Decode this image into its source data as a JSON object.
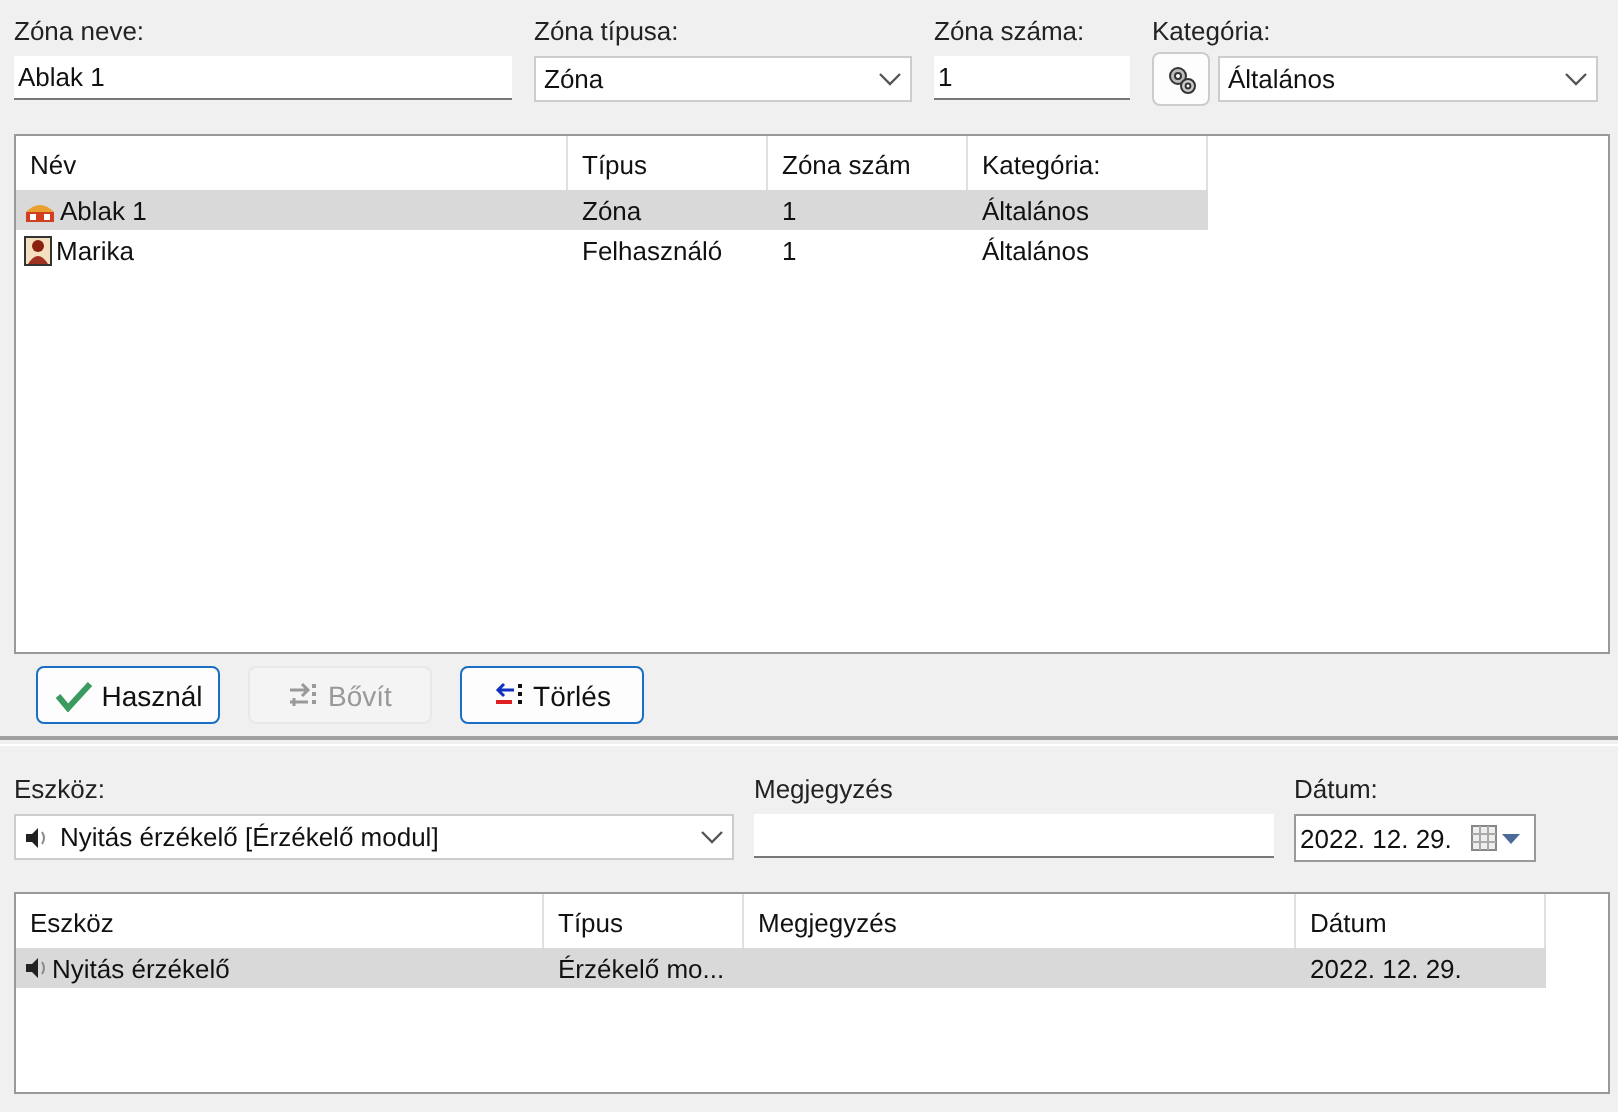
{
  "top_fields": [
    {
      "kind": "text",
      "label": "Zóna neve:",
      "value": "Ablak 1"
    },
    {
      "kind": "select",
      "label": "Zóna típusa:",
      "value": "Zóna"
    },
    {
      "kind": "text",
      "label": "Zóna száma:",
      "value": "1"
    },
    {
      "kind": "category",
      "label": "Kategória:",
      "value": "Általános"
    }
  ],
  "zones_table": {
    "columns": [
      "Név",
      "Típus",
      "Zóna szám",
      "Kategória:"
    ],
    "rows": [
      {
        "kind": "zone",
        "selected": true,
        "cells": [
          "Ablak 1",
          "Zóna",
          "1",
          "Általános"
        ]
      },
      {
        "kind": "user",
        "selected": false,
        "cells": [
          "Marika",
          "Felhasználó",
          "1",
          "Általános"
        ]
      }
    ]
  },
  "buttons": [
    {
      "kind": "use",
      "label": "Használ",
      "disabled": false
    },
    {
      "kind": "extend",
      "label": "Bővít",
      "disabled": true
    },
    {
      "kind": "delete",
      "label": "Törlés",
      "disabled": false
    }
  ],
  "device_fields": {
    "device_label": "Eszköz:",
    "device_value": "Nyitás érzékelő [Érzékelő modul]",
    "note_label": "Megjegyzés",
    "date_label": "Dátum:",
    "date_value": "2022. 12. 29."
  },
  "devices_table": {
    "columns": [
      "Eszköz",
      "Típus",
      "Megjegyzés",
      "Dátum"
    ],
    "rows": [
      {
        "selected": true,
        "cells": [
          "Nyitás érzékelő",
          "Érzékelő mo...",
          "",
          "2022. 12. 29."
        ]
      }
    ]
  }
}
